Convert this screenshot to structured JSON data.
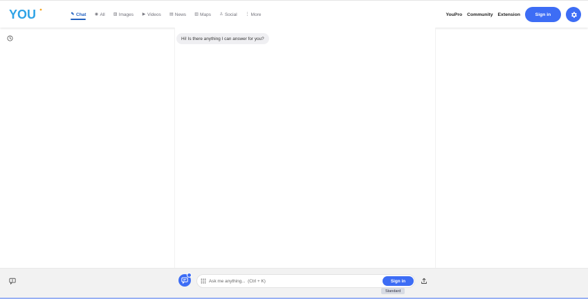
{
  "brand": {
    "logo_text": "YOU"
  },
  "nav": {
    "tabs": [
      {
        "label": "Chat",
        "icon": "chat-icon",
        "active": true
      },
      {
        "label": "All",
        "icon": "all-icon",
        "active": false
      },
      {
        "label": "Images",
        "icon": "images-icon",
        "active": false
      },
      {
        "label": "Videos",
        "icon": "videos-icon",
        "active": false
      },
      {
        "label": "News",
        "icon": "news-icon",
        "active": false
      },
      {
        "label": "Maps",
        "icon": "maps-icon",
        "active": false
      },
      {
        "label": "Social",
        "icon": "social-icon",
        "active": false
      },
      {
        "label": "More",
        "icon": "more-icon",
        "active": false
      }
    ],
    "right": {
      "youpro": "YouPro",
      "community": "Community",
      "extension": "Extension",
      "signin": "Sign in"
    }
  },
  "chat": {
    "greeting": "Hi! Is there anything I can answer for you?"
  },
  "composer": {
    "placeholder": "Ask me anything...  (Ctrl + K)",
    "signin": "Sign in",
    "mode": "Standard"
  },
  "colors": {
    "accent": "#3d6df5",
    "active_tab": "#1f5fbf"
  }
}
